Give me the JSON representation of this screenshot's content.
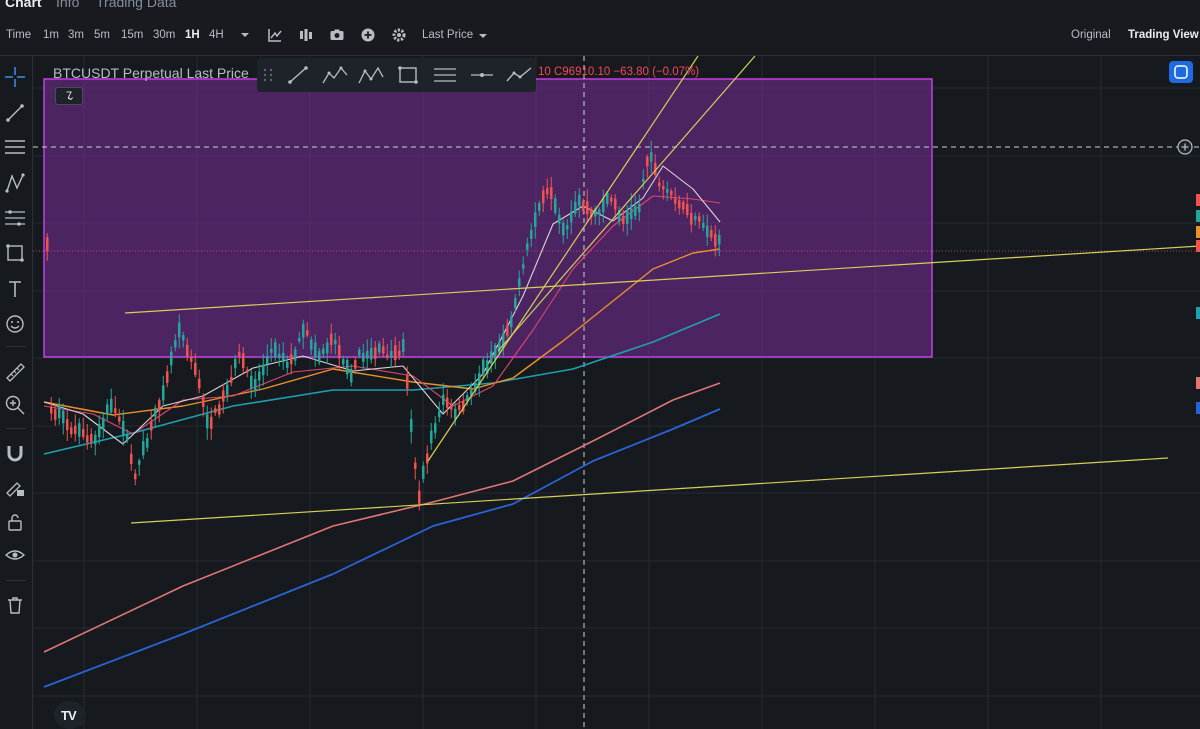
{
  "top_tabs": [
    "Chart",
    "Info",
    "Trading Data"
  ],
  "toolbar": {
    "time_label": "Time",
    "intervals": [
      "1m",
      "3m",
      "5m",
      "15m",
      "30m",
      "1H",
      "4H"
    ],
    "active_interval": "1H",
    "price_type": "Last Price",
    "view_original": "Original",
    "view_trading": "Trading View"
  },
  "chart": {
    "symbol_title": "BTCUSDT Perpetual Last Price",
    "ohlc_text": "10 C96910.10 −63.80 (−0.07%)",
    "indicator_count": "7",
    "logo_text": "TV"
  },
  "colors": {
    "up": "#26a69a",
    "down": "#ef5350",
    "rect_border": "#c040e0",
    "rect_fill": "#7a2e9a",
    "trend_yellow": "#d6cf58",
    "ma_white": "#d6d6d6",
    "ma_pink": "#e04472",
    "ma_orange": "#e8902a",
    "ma_teal": "#1fa0b0",
    "ma_salmon": "#e07575",
    "ma_blue": "#2a63d8"
  }
}
